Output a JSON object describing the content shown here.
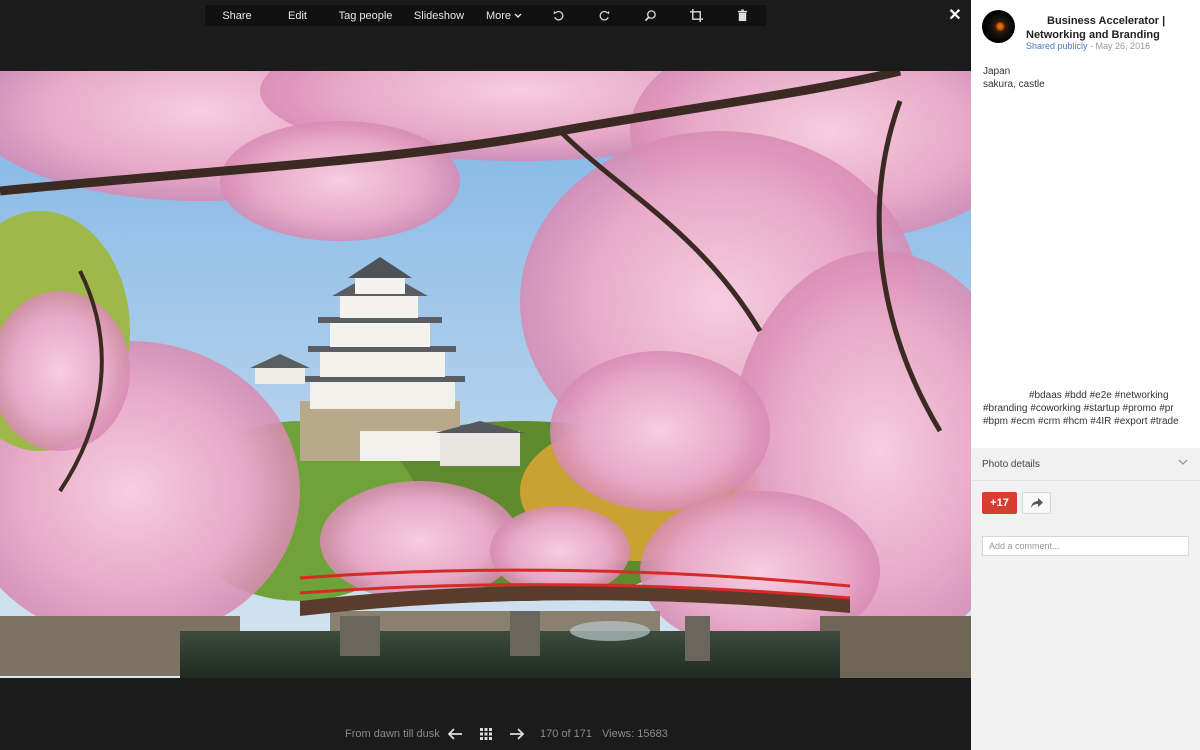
{
  "toolbar": {
    "share": "Share",
    "edit": "Edit",
    "tag_people": "Tag people",
    "slideshow": "Slideshow",
    "more": "More",
    "icons": [
      "rotate-left-icon",
      "rotate-right-icon",
      "zoom-icon",
      "crop-icon",
      "trash-icon"
    ]
  },
  "close_glyph": "✕",
  "album": {
    "title": "From dawn till dusk",
    "position": "170 of 171",
    "views": "Views: 15683"
  },
  "post": {
    "author_line1": "Business Accelerator |",
    "author_line2": "Networking and Branding",
    "visibility": "Shared publicly",
    "separator": " - ",
    "date": "May 26, 2016",
    "description_line1": "Japan",
    "description_line2": "sakura, castle",
    "tags_line1": "#bdaas #bdd #e2e #networking",
    "tags_line2": "#branding #coworking #startup #promo #pr",
    "tags_line3": "#bpm #ecm #crm #hcm #4IR #export #trade"
  },
  "photo_details": {
    "label": "Photo details"
  },
  "actions": {
    "plus_count": "+17"
  },
  "comment": {
    "placeholder": "Add a comment..."
  },
  "colors": {
    "plus_button": "#d73e32",
    "link": "#4a77c2",
    "viewer_bg": "#1b1b1b",
    "sidebar_bg": "#f1f1f1"
  }
}
